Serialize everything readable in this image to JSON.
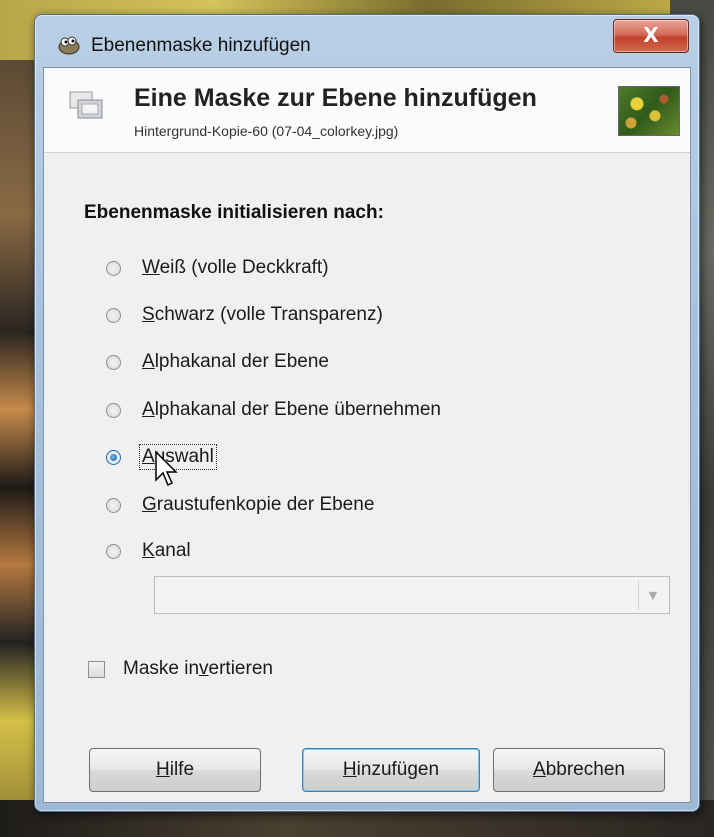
{
  "window": {
    "title": "Ebenenmaske hinzufügen",
    "close_label": "X"
  },
  "header": {
    "title": "Eine Maske zur Ebene hinzufügen",
    "subtitle": "Hintergrund-Kopie-60 (07-04_colorkey.jpg)"
  },
  "section_label": "Ebenenmaske initialisieren nach:",
  "options": [
    {
      "accel": "W",
      "rest": "eiß (volle Deckkraft)",
      "checked": false
    },
    {
      "accel": "S",
      "rest": "chwarz (volle Transparenz)",
      "checked": false
    },
    {
      "accel": "A",
      "rest": "lphakanal der Ebene",
      "checked": false
    },
    {
      "accel": "A",
      "rest": "lphakanal der Ebene übernehmen",
      "checked": false
    },
    {
      "accel": "A",
      "rest": "uswahl",
      "checked": true
    },
    {
      "accel": "G",
      "rest": "raustufenkopie der Ebene",
      "checked": false
    },
    {
      "accel": "K",
      "rest": "anal",
      "checked": false
    }
  ],
  "channel_select": {
    "value": "",
    "arrow": "▼"
  },
  "invert": {
    "pre": "Maske in",
    "accel": "v",
    "post": "ertieren",
    "checked": false
  },
  "buttons": {
    "help": {
      "accel": "H",
      "rest": "ilfe"
    },
    "add": {
      "accel": "H",
      "rest": "inzufügen"
    },
    "cancel": {
      "accel": "A",
      "rest": "bbrechen"
    }
  }
}
